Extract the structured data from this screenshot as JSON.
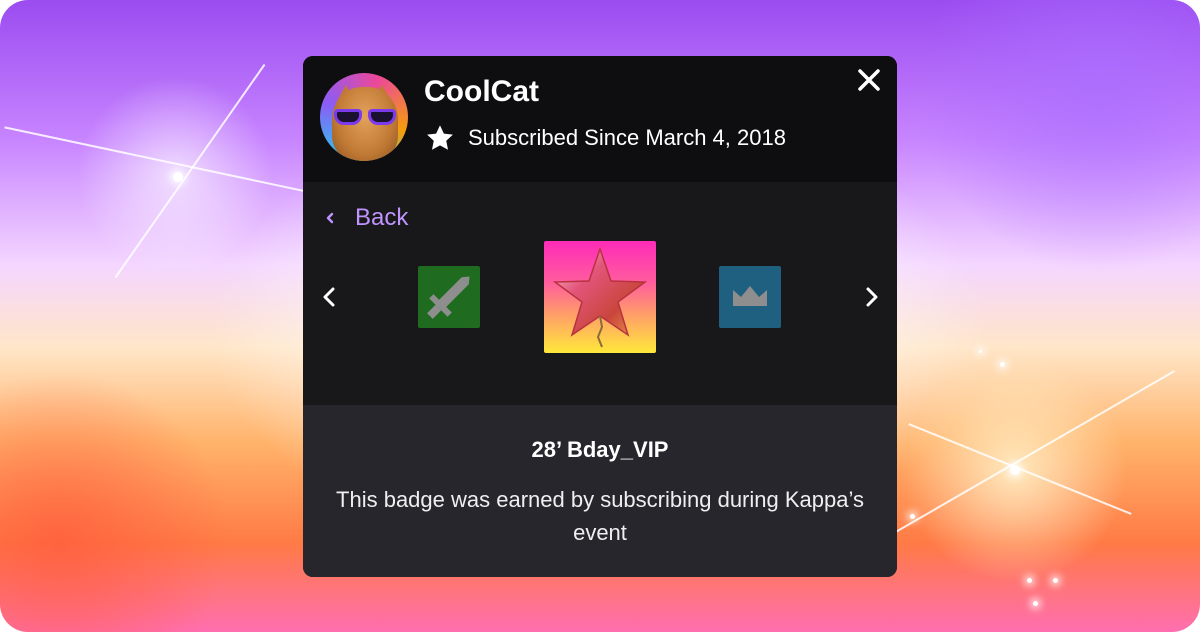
{
  "profile": {
    "username": "CoolCat",
    "subscription_text": "Subscribed Since March 4, 2018"
  },
  "navigation": {
    "back_label": "Back"
  },
  "badges": [
    {
      "name": "sword-badge",
      "color": "#1f6b1f",
      "icon": "sword-icon"
    },
    {
      "name": "star-balloon-badge",
      "color": "#ff2bb8",
      "icon": "star-balloon-icon",
      "selected": true
    },
    {
      "name": "crown-badge",
      "color": "#1f5f80",
      "icon": "crown-icon"
    }
  ],
  "selected_badge": {
    "title": "28’ Bday_VIP",
    "description": "This badge was earned by subscribing during Kappa’s event"
  },
  "colors": {
    "card_bg": "#18181b",
    "header_bg": "#0e0e10",
    "detail_bg": "#26262c",
    "accent": "#bf94ff"
  }
}
